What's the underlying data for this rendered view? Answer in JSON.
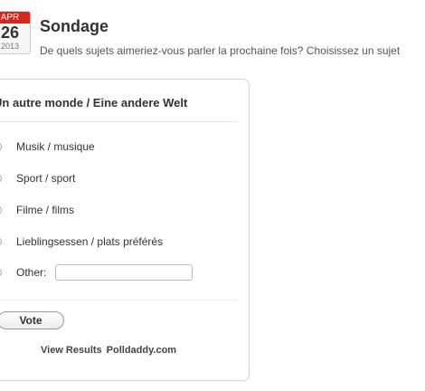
{
  "post": {
    "date": {
      "month": "APR",
      "day": "26",
      "year": "2013"
    },
    "title": "Sondage",
    "excerpt": "De quels sujets aimeriez-vous parler la prochaine fois? Choisissez un sujet"
  },
  "poll": {
    "question": "Un autre monde / Eine andere Welt",
    "answers": [
      {
        "label": "Musik / musique"
      },
      {
        "label": "Sport / sport"
      },
      {
        "label": "Filme / films"
      },
      {
        "label": "Lieblingsessen / plats préférés"
      }
    ],
    "other_label": "Other:",
    "other_value": "",
    "vote_label": "Vote",
    "view_results_label": "View Results",
    "brand_label": "Polldaddy.com"
  },
  "colors": {
    "calendar_red": "#d9261c",
    "text_dark": "#333333",
    "card_border": "#d6d6d6"
  }
}
